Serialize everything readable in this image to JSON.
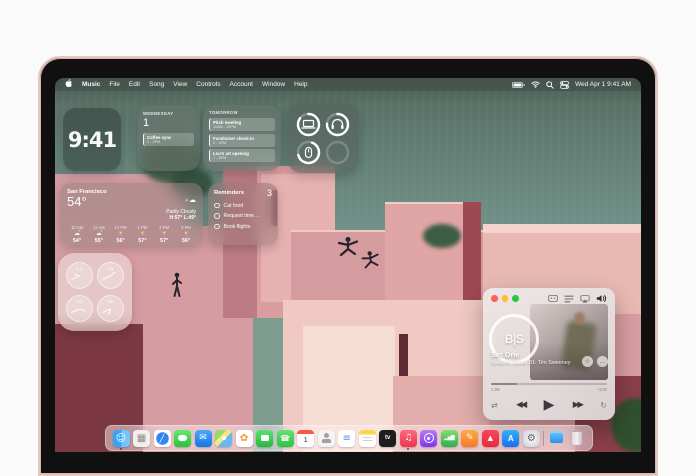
{
  "menu_bar": {
    "items": [
      "Music",
      "File",
      "Edit",
      "Song",
      "View",
      "Controls",
      "Account",
      "Window",
      "Help"
    ],
    "status_clock": "Wed Apr 1  9:41 AM",
    "status_icons": [
      "battery-icon",
      "wifi-icon",
      "search-icon",
      "control-center-icon"
    ]
  },
  "widgets": {
    "clock": {
      "time": "9:41"
    },
    "calendar": {
      "weekday": "WEDNESDAY",
      "day": "1",
      "event_title": "Coffee sync",
      "event_time": "1 - 2PM"
    },
    "tomorrow": {
      "title": "TOMORROW",
      "events": [
        {
          "title": "Pitch meeting",
          "time": "11AM - 12PM"
        },
        {
          "title": "Fundraiser check-in",
          "time": "3 - 4PM"
        },
        {
          "title": "Lou's art opening",
          "time": "7 - 8PM"
        }
      ]
    },
    "batteries": {
      "devices": [
        "laptop",
        "headphones",
        "mouse",
        "empty-slot"
      ]
    },
    "weather": {
      "city": "San Francisco",
      "temperature": "54°",
      "condition": "Partly Cloudy",
      "high_low": "H:57° L:49°",
      "hourly": [
        {
          "time": "10 AM",
          "icon": "partly-cloudy",
          "temp": "54°"
        },
        {
          "time": "11 AM",
          "icon": "partly-cloudy",
          "temp": "55°"
        },
        {
          "time": "12 PM",
          "icon": "sunny",
          "temp": "56°"
        },
        {
          "time": "1 PM",
          "icon": "sunny",
          "temp": "57°"
        },
        {
          "time": "2 PM",
          "icon": "sunny",
          "temp": "57°"
        },
        {
          "time": "3 PM",
          "icon": "sunny",
          "temp": "56°"
        }
      ]
    },
    "reminders": {
      "title": "Reminders",
      "count": "3",
      "items": [
        "Cat food",
        "Request time…",
        "Book flights"
      ]
    },
    "world_clock": {
      "cities": [
        "CUP",
        "TOK",
        "SYD",
        "PAR"
      ]
    }
  },
  "music_player": {
    "monogram": "B|S",
    "title": "Set One",
    "subtitle": "Beats In Space 01: Tim Sweeney",
    "elapsed": "1:08",
    "remaining": "-4:02",
    "top_icons": [
      "lyrics-icon",
      "queue-icon",
      "airplay-icon",
      "volume-icon"
    ],
    "controls": [
      "shuffle",
      "rewind",
      "play",
      "forward",
      "repeat"
    ]
  },
  "dock": {
    "icons": [
      "finder",
      "launchpad",
      "safari",
      "messages",
      "mail",
      "maps",
      "photos",
      "facetime",
      "phone",
      "calendar",
      "contacts",
      "reminders",
      "notes",
      "tv",
      "music",
      "podcasts",
      "numbers",
      "pages",
      "rocket",
      "app-store",
      "settings",
      "downloads",
      "trash"
    ],
    "calendar_day": "1",
    "tv_label": "tv",
    "app_store_label": "A"
  },
  "colors": {
    "sea": "#6b8a7d",
    "pink_wall": "#dca4a6",
    "maroon_wall": "#7c3843",
    "bezel_edge": "#e6c6c0",
    "traffic_red": "#ff5f57",
    "traffic_yellow": "#febc2e",
    "traffic_green": "#29c83f"
  }
}
